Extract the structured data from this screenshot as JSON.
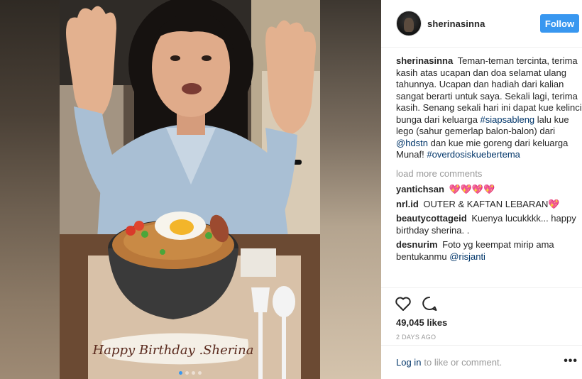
{
  "post": {
    "image_alt": "Woman with a noodle bowl cake reading Happy Birthday Sherina",
    "cake_text": "Happy Birthday .Sherina",
    "carousel_dots": 4,
    "active_dot": 1
  },
  "header": {
    "username": "sherinasinna",
    "follow_label": "Follow"
  },
  "caption": {
    "username": "sherinasinna",
    "text_1": "Teman-teman tercinta, terima kasih atas ucapan dan doa selamat ulang tahunnya. Ucapan dan hadiah dari kalian sangat berarti untuk saya. Sekali lagi, terima kasih. Senang sekali hari ini dapat kue kelinci bunga dari keluarga",
    "tag_1": "#siapsableng",
    "text_2": "lalu kue lego (sahur gemerlap balon-balon) dari",
    "tag_2": "@hdstn",
    "text_3": "dan kue mie goreng dari keluarga Munaf!",
    "tag_3": "#overdosiskuebertema"
  },
  "load_more": "load more comments",
  "comments": [
    {
      "username": "yantichsan",
      "text": "💖💖💖💖"
    },
    {
      "username": "nrl.id",
      "text": "OUTER & KAFTAN LEBARAN💖"
    },
    {
      "username": "beautycottageid",
      "text": "Kuenya lucukkkk... happy birthday sherina. ."
    },
    {
      "username": "desnurim",
      "text": "Foto yg keempat mirip ama bentukanmu",
      "tag": "@risjanti"
    }
  ],
  "actions": {
    "like_icon": "heart-icon",
    "comment_icon": "comment-icon",
    "likes": "49,045 likes",
    "date": "2 DAYS AGO"
  },
  "footer": {
    "login_label": "Log in",
    "rest": "to like or comment.",
    "options": "•••"
  }
}
